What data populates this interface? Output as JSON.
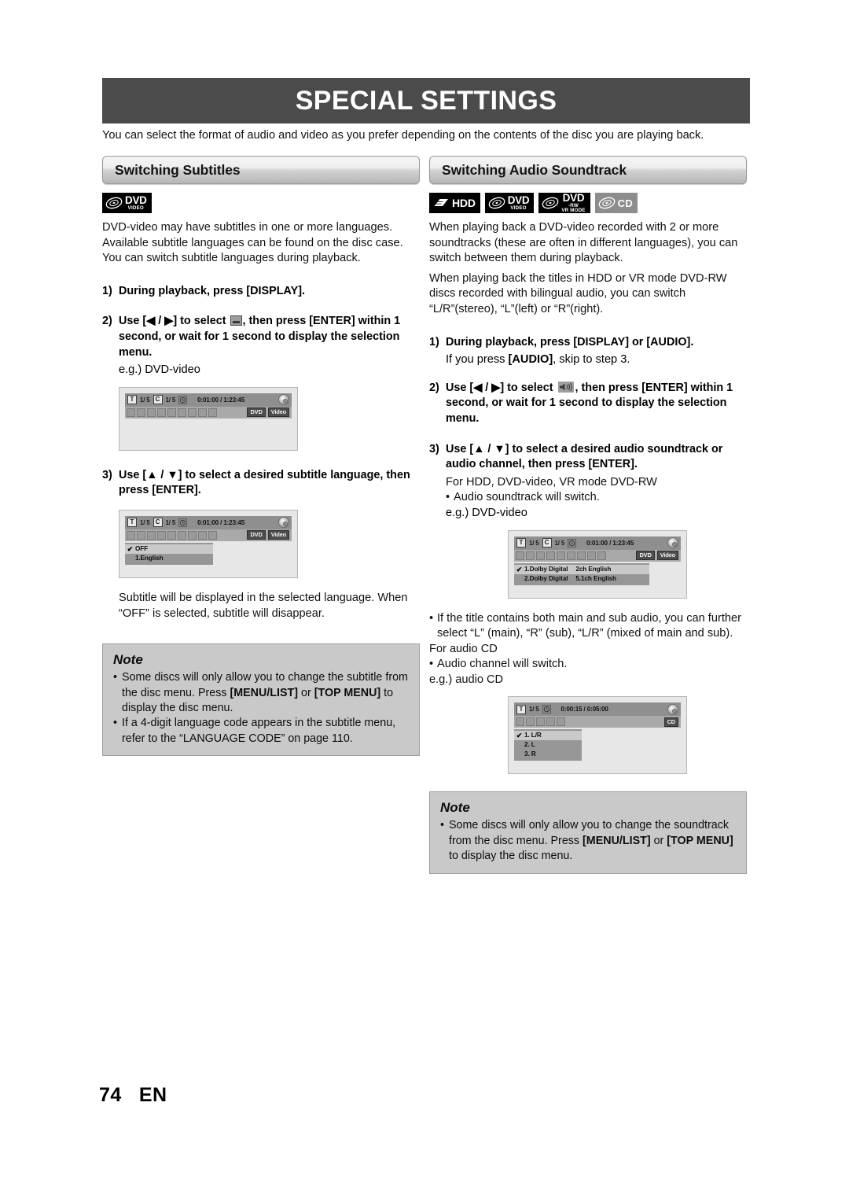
{
  "banner": {
    "title": "SPECIAL SETTINGS"
  },
  "intro": "You can select the format of audio and video as you prefer depending on the contents of the disc you are playing back.",
  "footer": {
    "page_number": "74",
    "language": "EN"
  },
  "colors": {
    "banner_bg": "#4b4b4b",
    "note_bg": "#c9c9c9",
    "osd_bg": "#e7e7e7",
    "osd_bar": "#8f8f8f",
    "badge_black": "#000000",
    "badge_gray": "#8d8d8d"
  },
  "left": {
    "heading": "Switching Subtitles",
    "badges": [
      {
        "name": "dvd-video-badge",
        "main": "DVD",
        "sub": "VIDEO",
        "sub2": "",
        "style": "black"
      }
    ],
    "intro_paragraph": "DVD-video may have subtitles in one or more languages. Available subtitle languages can be found on the disc case. You can switch subtitle languages during playback.",
    "steps": [
      {
        "num": "1)",
        "text": "During playback, press [DISPLAY]."
      },
      {
        "num": "2)",
        "pre": "Use [◀ / ▶] to select",
        "post": ", then press [ENTER] within 1 second, or wait for 1 second to display the selection menu.",
        "icon": "subtitle-icon",
        "example_label": "e.g.) DVD-video"
      },
      {
        "num": "3)",
        "text": "Use [▲ / ▼] to select a desired subtitle language, then press [ENTER]."
      }
    ],
    "closing": "Subtitle will be displayed in the selected language. When “OFF” is selected, subtitle will disappear.",
    "osd_plain": {
      "title_key": "T",
      "title_value": "1/  5",
      "chapter_key": "C",
      "chapter_value": "1/  5",
      "time": "0:01:00 / 1:23:45",
      "tags": [
        "DVD",
        "Video"
      ]
    },
    "osd_menu": {
      "title_key": "T",
      "title_value": "1/  5",
      "chapter_key": "C",
      "chapter_value": "1/  5",
      "time": "0:01:00 / 1:23:45",
      "tags": [
        "DVD",
        "Video"
      ],
      "items": [
        {
          "checked": true,
          "label": "OFF"
        },
        {
          "checked": false,
          "label": "1.English"
        }
      ]
    },
    "note": {
      "title": "Note",
      "items": [
        "Some discs will only allow you to change the subtitle from the disc menu. Press [MENU/LIST] or [TOP MENU] to display the disc menu.",
        "If a 4-digit language code appears in the subtitle menu, refer to the “LANGUAGE CODE” on page 110."
      ]
    }
  },
  "right": {
    "heading": "Switching Audio Soundtrack",
    "badges": [
      {
        "name": "hdd-badge",
        "main": "HDD",
        "sub": "",
        "sub2": "",
        "style": "black"
      },
      {
        "name": "dvd-video-badge",
        "main": "DVD",
        "sub": "VIDEO",
        "sub2": "",
        "style": "black"
      },
      {
        "name": "dvd-rw-vr-badge",
        "main": "DVD",
        "sub": "-RW",
        "sub2": "VR MODE",
        "style": "black"
      },
      {
        "name": "cd-badge",
        "main": "CD",
        "sub": "",
        "sub2": "",
        "style": "gray"
      }
    ],
    "paragraph_1": "When playing back a DVD-video recorded with 2 or more soundtracks (these are often in different languages), you can switch between them during playback.",
    "paragraph_2": "When playing back the titles in HDD or VR mode DVD-RW discs recorded with bilingual audio, you can switch “L/R”(stereo), “L”(left) or “R”(right).",
    "steps": [
      {
        "num": "1)",
        "text": "During playback, press [DISPLAY] or [AUDIO].",
        "sub_pre": "If you press ",
        "sub_bold": "[AUDIO]",
        "sub_post": ", skip to step 3."
      },
      {
        "num": "2)",
        "pre": "Use [◀ / ▶] to select",
        "post": ", then press [ENTER] within 1 second, or wait for 1 second to display the selection menu.",
        "icon": "audio-icon"
      },
      {
        "num": "3)",
        "text": "Use [▲ / ▼] to select a desired audio soundtrack or audio channel, then press [ENTER]."
      }
    ],
    "for_hdd_label": "For HDD, DVD-video, VR mode DVD-RW",
    "bullet_soundtrack": "Audio soundtrack will switch.",
    "example_dvd": "e.g.) DVD-video",
    "bullet_main_sub": "If the title contains both main and sub audio, you can further select “L” (main), “R” (sub), “L/R” (mixed of main and sub).",
    "for_cd_label": "For audio CD",
    "bullet_channel": "Audio channel will switch.",
    "example_cd": "e.g.) audio CD",
    "osd_dvd": {
      "title_key": "T",
      "title_value": "1/  5",
      "chapter_key": "C",
      "chapter_value": "1/  5",
      "time": "0:01:00 / 1:23:45",
      "tags": [
        "DVD",
        "Video"
      ],
      "items": [
        {
          "checked": true,
          "label": "1.Dolby Digital",
          "label2": "2ch English"
        },
        {
          "checked": false,
          "label": "2.Dolby Digital",
          "label2": "5.1ch English"
        }
      ]
    },
    "osd_cd": {
      "title_key": "T",
      "title_value": "1/  5",
      "time": "0:00:15 / 0:05:00",
      "tags": [
        "CD"
      ],
      "items": [
        {
          "checked": true,
          "label": "1. L/R"
        },
        {
          "checked": false,
          "label": "2. L"
        },
        {
          "checked": false,
          "label": "3. R"
        }
      ]
    },
    "note": {
      "title": "Note",
      "items": [
        "Some discs will only allow you to change the soundtrack from the disc menu. Press [MENU/LIST] or [TOP MENU] to display the disc menu."
      ]
    }
  }
}
